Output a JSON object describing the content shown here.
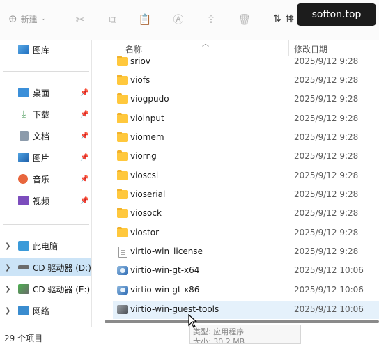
{
  "toolbar": {
    "new_label": "新建",
    "sort_label": "排",
    "icons": [
      "cut-icon",
      "copy-icon",
      "paste-icon",
      "rename-icon",
      "share-icon",
      "delete-icon",
      "sort-icon"
    ]
  },
  "watermark": "softon.top",
  "sidebar": {
    "items": [
      {
        "label": "图库",
        "icon": "gallery-icon",
        "pinned": false
      },
      {
        "label": "桌面",
        "icon": "desktop-icon",
        "pinned": true
      },
      {
        "label": "下载",
        "icon": "download-icon",
        "pinned": true
      },
      {
        "label": "文档",
        "icon": "documents-icon",
        "pinned": true
      },
      {
        "label": "图片",
        "icon": "pictures-icon",
        "pinned": true
      },
      {
        "label": "音乐",
        "icon": "music-icon",
        "pinned": true
      },
      {
        "label": "视频",
        "icon": "videos-icon",
        "pinned": true
      },
      {
        "label": "此电脑",
        "icon": "this-pc-icon",
        "expandable": true
      },
      {
        "label": "CD 驱动器 (D:)",
        "icon": "cd-drive-icon",
        "expandable": true,
        "selected": true
      },
      {
        "label": "CD 驱动器 (E:)",
        "icon": "cd-drive-icon",
        "expandable": true
      },
      {
        "label": "网络",
        "icon": "network-icon",
        "expandable": true
      }
    ]
  },
  "columns": {
    "name": "名称",
    "modified": "修改日期"
  },
  "files": [
    {
      "name": "sriov",
      "date": "2025/9/12 9:28",
      "type": "folder"
    },
    {
      "name": "viofs",
      "date": "2025/9/12 9:28",
      "type": "folder"
    },
    {
      "name": "viogpudo",
      "date": "2025/9/12 9:28",
      "type": "folder"
    },
    {
      "name": "vioinput",
      "date": "2025/9/12 9:28",
      "type": "folder"
    },
    {
      "name": "viomem",
      "date": "2025/9/12 9:28",
      "type": "folder"
    },
    {
      "name": "viorng",
      "date": "2025/9/12 9:28",
      "type": "folder"
    },
    {
      "name": "vioscsi",
      "date": "2025/9/12 9:28",
      "type": "folder"
    },
    {
      "name": "vioserial",
      "date": "2025/9/12 9:28",
      "type": "folder"
    },
    {
      "name": "viosock",
      "date": "2025/9/12 9:28",
      "type": "folder"
    },
    {
      "name": "viostor",
      "date": "2025/9/12 9:28",
      "type": "folder"
    },
    {
      "name": "virtio-win_license",
      "date": "2025/9/12 9:28",
      "type": "document"
    },
    {
      "name": "virtio-win-gt-x64",
      "date": "2025/9/12 10:06",
      "type": "installer"
    },
    {
      "name": "virtio-win-gt-x86",
      "date": "2025/9/12 10:06",
      "type": "installer"
    },
    {
      "name": "virtio-win-guest-tools",
      "date": "2025/9/12 10:06",
      "type": "application",
      "hovered": true
    }
  ],
  "tooltip": {
    "type_line": "类型: 应用程序",
    "size_line": "大小: 30.2 MB"
  },
  "status": {
    "count": "29 个项目"
  }
}
